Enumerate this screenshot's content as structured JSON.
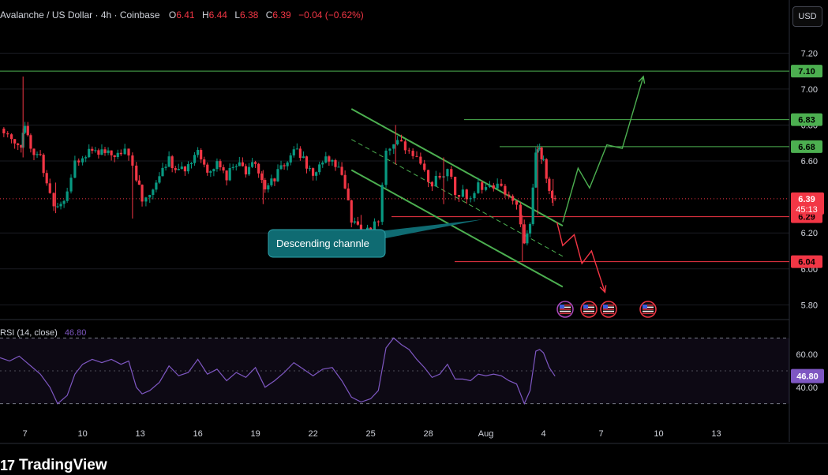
{
  "header": {
    "symbol": "Avalanche / US Dollar · 4h · Coinbase",
    "o_label": "O",
    "o_value": "6.41",
    "h_label": "H",
    "h_value": "6.44",
    "l_label": "L",
    "l_value": "6.38",
    "c_label": "C",
    "c_value": "6.39",
    "change": "−0.04 (−0.62%)"
  },
  "currency_button": "USD",
  "annotation": "Descending channle",
  "rsi_header": {
    "label": "RSI (14, close)",
    "value": "46.80"
  },
  "brand": {
    "logo_mark": "17",
    "name": "TradingView"
  },
  "colors": {
    "up": "#089981",
    "down": "#f23645",
    "channel": "#4caf50",
    "callout": "#0f6b72",
    "rsi": "#7e57c2"
  },
  "chart_data": [
    {
      "type": "candlestick",
      "y_ticks": [
        "7.20",
        "7.00",
        "6.80",
        "6.60",
        "6.20",
        "6.00",
        "5.80"
      ],
      "ylim": [
        5.74,
        7.32
      ],
      "x_ticks": [
        {
          "label": "7",
          "x": 7
        },
        {
          "label": "10",
          "x": 10
        },
        {
          "label": "13",
          "x": 13
        },
        {
          "label": "16",
          "x": 16
        },
        {
          "label": "19",
          "x": 19
        },
        {
          "label": "22",
          "x": 22
        },
        {
          "label": "25",
          "x": 25
        },
        {
          "label": "28",
          "x": 28
        },
        {
          "label": "Aug",
          "x": 31
        },
        {
          "label": "4",
          "x": 34
        },
        {
          "label": "7",
          "x": 37
        },
        {
          "label": "10",
          "x": 40
        },
        {
          "label": "13",
          "x": 43
        }
      ],
      "xlim": [
        5.7,
        46.8
      ],
      "close_path": [
        [
          5.7,
          6.78
        ],
        [
          6.3,
          6.74
        ],
        [
          6.8,
          6.7
        ],
        [
          7.0,
          6.78
        ],
        [
          7.3,
          6.68
        ],
        [
          7.8,
          6.62
        ],
        [
          8.3,
          6.4
        ],
        [
          8.7,
          6.34
        ],
        [
          9.2,
          6.42
        ],
        [
          9.6,
          6.58
        ],
        [
          10.0,
          6.62
        ],
        [
          10.5,
          6.66
        ],
        [
          11.0,
          6.64
        ],
        [
          11.5,
          6.66
        ],
        [
          12.0,
          6.63
        ],
        [
          12.4,
          6.66
        ],
        [
          12.8,
          6.48
        ],
        [
          13.1,
          6.4
        ],
        [
          13.5,
          6.44
        ],
        [
          14.0,
          6.5
        ],
        [
          14.5,
          6.6
        ],
        [
          15.0,
          6.53
        ],
        [
          15.5,
          6.58
        ],
        [
          16.0,
          6.66
        ],
        [
          16.5,
          6.54
        ],
        [
          17.0,
          6.6
        ],
        [
          17.5,
          6.52
        ],
        [
          18.0,
          6.58
        ],
        [
          18.5,
          6.53
        ],
        [
          19.0,
          6.6
        ],
        [
          19.5,
          6.45
        ],
        [
          20.0,
          6.51
        ],
        [
          20.5,
          6.58
        ],
        [
          21.0,
          6.66
        ],
        [
          21.5,
          6.6
        ],
        [
          22.0,
          6.54
        ],
        [
          22.5,
          6.6
        ],
        [
          23.0,
          6.62
        ],
        [
          23.5,
          6.5
        ],
        [
          24.0,
          6.28
        ],
        [
          24.5,
          6.2
        ],
        [
          25.0,
          6.24
        ],
        [
          25.4,
          6.28
        ],
        [
          25.8,
          6.66
        ],
        [
          26.2,
          6.72
        ],
        [
          26.6,
          6.68
        ],
        [
          27.0,
          6.66
        ],
        [
          27.4,
          6.6
        ],
        [
          27.8,
          6.54
        ],
        [
          28.2,
          6.48
        ],
        [
          28.6,
          6.5
        ],
        [
          29.0,
          6.58
        ],
        [
          29.4,
          6.44
        ],
        [
          29.8,
          6.42
        ],
        [
          30.2,
          6.4
        ],
        [
          30.6,
          6.46
        ],
        [
          31.0,
          6.44
        ],
        [
          31.4,
          6.45
        ],
        [
          31.8,
          6.44
        ],
        [
          32.2,
          6.4
        ],
        [
          32.6,
          6.38
        ],
        [
          33.0,
          6.12
        ],
        [
          33.3,
          6.26
        ],
        [
          33.6,
          6.62
        ],
        [
          33.8,
          6.66
        ],
        [
          34.0,
          6.6
        ],
        [
          34.3,
          6.44
        ],
        [
          34.6,
          6.39
        ]
      ],
      "wicks": [
        [
          6.9,
          6.62,
          7.07
        ],
        [
          8.6,
          6.31,
          6.48
        ],
        [
          12.6,
          6.28,
          6.6
        ],
        [
          19.4,
          6.36,
          6.55
        ],
        [
          24.5,
          6.13,
          6.3
        ],
        [
          26.3,
          6.58,
          6.8
        ],
        [
          28.8,
          6.36,
          6.62
        ],
        [
          32.9,
          6.04,
          6.3
        ],
        [
          33.7,
          6.3,
          6.68
        ],
        [
          34.5,
          6.35,
          6.5
        ]
      ],
      "levels": [
        {
          "label": "7.10",
          "value": 7.1,
          "color": "#4caf50"
        },
        {
          "label": "6.83",
          "value": 6.83,
          "color": "#4caf50"
        },
        {
          "label": "6.68",
          "value": 6.68,
          "color": "#4caf50"
        },
        {
          "label": "6.29",
          "value": 6.29,
          "color": "#f23645"
        },
        {
          "label": "6.04",
          "value": 6.04,
          "color": "#f23645"
        }
      ],
      "last_price": {
        "label": "6.39",
        "value": 6.39,
        "countdown": "45:13"
      },
      "channel": {
        "upper": [
          [
            24.0,
            6.89
          ],
          [
            35.0,
            6.24
          ]
        ],
        "lower": [
          [
            24.0,
            6.55
          ],
          [
            35.0,
            5.9
          ]
        ],
        "mid": [
          [
            24.0,
            6.72
          ],
          [
            35.0,
            6.07
          ]
        ]
      },
      "bull_path": [
        [
          35.0,
          6.26
        ],
        [
          35.8,
          6.56
        ],
        [
          36.4,
          6.45
        ],
        [
          37.3,
          6.69
        ],
        [
          38.1,
          6.67
        ],
        [
          39.2,
          7.07
        ]
      ],
      "bear_path": [
        [
          34.7,
          6.26
        ],
        [
          35.0,
          6.13
        ],
        [
          35.6,
          6.19
        ],
        [
          36.0,
          6.03
        ],
        [
          36.5,
          6.1
        ],
        [
          37.2,
          5.87
        ]
      ],
      "event_markers": 4
    },
    {
      "type": "line",
      "name": "RSI (14, close)",
      "y_ticks": [
        "60.00",
        "40.00"
      ],
      "ylim": [
        25,
        75
      ],
      "bands": [
        70,
        30
      ],
      "mid": 50,
      "last": {
        "label": "46.80",
        "value": 46.8
      },
      "points": [
        [
          5.7,
          58
        ],
        [
          6.2,
          56
        ],
        [
          6.7,
          59
        ],
        [
          7.0,
          56
        ],
        [
          7.3,
          53
        ],
        [
          7.8,
          48
        ],
        [
          8.3,
          40
        ],
        [
          8.7,
          30
        ],
        [
          9.2,
          35
        ],
        [
          9.6,
          48
        ],
        [
          10.0,
          54
        ],
        [
          10.5,
          57
        ],
        [
          11.0,
          55
        ],
        [
          11.5,
          57
        ],
        [
          12.0,
          54
        ],
        [
          12.4,
          56
        ],
        [
          12.8,
          40
        ],
        [
          13.1,
          36
        ],
        [
          13.5,
          38
        ],
        [
          14.0,
          43
        ],
        [
          14.5,
          53
        ],
        [
          15.0,
          47
        ],
        [
          15.5,
          49
        ],
        [
          16.0,
          57
        ],
        [
          16.5,
          48
        ],
        [
          17.0,
          51
        ],
        [
          17.5,
          44
        ],
        [
          18.0,
          49
        ],
        [
          18.5,
          46
        ],
        [
          19.0,
          52
        ],
        [
          19.5,
          40
        ],
        [
          20.0,
          44
        ],
        [
          20.5,
          49
        ],
        [
          21.0,
          55
        ],
        [
          21.5,
          51
        ],
        [
          22.0,
          47
        ],
        [
          22.5,
          51
        ],
        [
          23.0,
          52
        ],
        [
          23.5,
          44
        ],
        [
          24.0,
          34
        ],
        [
          24.5,
          31
        ],
        [
          25.0,
          33
        ],
        [
          25.4,
          38
        ],
        [
          25.8,
          64
        ],
        [
          26.2,
          70
        ],
        [
          26.6,
          66
        ],
        [
          27.0,
          63
        ],
        [
          27.4,
          57
        ],
        [
          27.8,
          52
        ],
        [
          28.2,
          46
        ],
        [
          28.6,
          48
        ],
        [
          29.0,
          54
        ],
        [
          29.4,
          45
        ],
        [
          29.8,
          45
        ],
        [
          30.2,
          44
        ],
        [
          30.6,
          48
        ],
        [
          31.0,
          47
        ],
        [
          31.4,
          48
        ],
        [
          31.8,
          47
        ],
        [
          32.2,
          44
        ],
        [
          32.6,
          42
        ],
        [
          33.0,
          30
        ],
        [
          33.3,
          38
        ],
        [
          33.6,
          62
        ],
        [
          33.8,
          63
        ],
        [
          34.0,
          61
        ],
        [
          34.3,
          52
        ],
        [
          34.6,
          46.8
        ]
      ]
    }
  ]
}
